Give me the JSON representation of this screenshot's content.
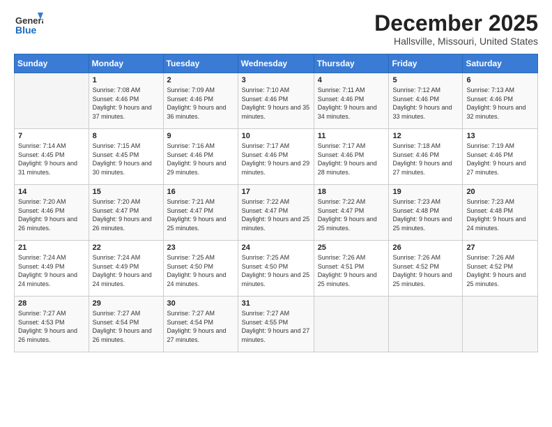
{
  "header": {
    "logo_general": "General",
    "logo_blue": "Blue",
    "title": "December 2025",
    "subtitle": "Hallsville, Missouri, United States"
  },
  "calendar": {
    "days_of_week": [
      "Sunday",
      "Monday",
      "Tuesday",
      "Wednesday",
      "Thursday",
      "Friday",
      "Saturday"
    ],
    "weeks": [
      [
        {
          "day": "",
          "sunrise": "",
          "sunset": "",
          "daylight": ""
        },
        {
          "day": "1",
          "sunrise": "Sunrise: 7:08 AM",
          "sunset": "Sunset: 4:46 PM",
          "daylight": "Daylight: 9 hours and 37 minutes."
        },
        {
          "day": "2",
          "sunrise": "Sunrise: 7:09 AM",
          "sunset": "Sunset: 4:46 PM",
          "daylight": "Daylight: 9 hours and 36 minutes."
        },
        {
          "day": "3",
          "sunrise": "Sunrise: 7:10 AM",
          "sunset": "Sunset: 4:46 PM",
          "daylight": "Daylight: 9 hours and 35 minutes."
        },
        {
          "day": "4",
          "sunrise": "Sunrise: 7:11 AM",
          "sunset": "Sunset: 4:46 PM",
          "daylight": "Daylight: 9 hours and 34 minutes."
        },
        {
          "day": "5",
          "sunrise": "Sunrise: 7:12 AM",
          "sunset": "Sunset: 4:46 PM",
          "daylight": "Daylight: 9 hours and 33 minutes."
        },
        {
          "day": "6",
          "sunrise": "Sunrise: 7:13 AM",
          "sunset": "Sunset: 4:46 PM",
          "daylight": "Daylight: 9 hours and 32 minutes."
        }
      ],
      [
        {
          "day": "7",
          "sunrise": "Sunrise: 7:14 AM",
          "sunset": "Sunset: 4:45 PM",
          "daylight": "Daylight: 9 hours and 31 minutes."
        },
        {
          "day": "8",
          "sunrise": "Sunrise: 7:15 AM",
          "sunset": "Sunset: 4:45 PM",
          "daylight": "Daylight: 9 hours and 30 minutes."
        },
        {
          "day": "9",
          "sunrise": "Sunrise: 7:16 AM",
          "sunset": "Sunset: 4:46 PM",
          "daylight": "Daylight: 9 hours and 29 minutes."
        },
        {
          "day": "10",
          "sunrise": "Sunrise: 7:17 AM",
          "sunset": "Sunset: 4:46 PM",
          "daylight": "Daylight: 9 hours and 29 minutes."
        },
        {
          "day": "11",
          "sunrise": "Sunrise: 7:17 AM",
          "sunset": "Sunset: 4:46 PM",
          "daylight": "Daylight: 9 hours and 28 minutes."
        },
        {
          "day": "12",
          "sunrise": "Sunrise: 7:18 AM",
          "sunset": "Sunset: 4:46 PM",
          "daylight": "Daylight: 9 hours and 27 minutes."
        },
        {
          "day": "13",
          "sunrise": "Sunrise: 7:19 AM",
          "sunset": "Sunset: 4:46 PM",
          "daylight": "Daylight: 9 hours and 27 minutes."
        }
      ],
      [
        {
          "day": "14",
          "sunrise": "Sunrise: 7:20 AM",
          "sunset": "Sunset: 4:46 PM",
          "daylight": "Daylight: 9 hours and 26 minutes."
        },
        {
          "day": "15",
          "sunrise": "Sunrise: 7:20 AM",
          "sunset": "Sunset: 4:47 PM",
          "daylight": "Daylight: 9 hours and 26 minutes."
        },
        {
          "day": "16",
          "sunrise": "Sunrise: 7:21 AM",
          "sunset": "Sunset: 4:47 PM",
          "daylight": "Daylight: 9 hours and 25 minutes."
        },
        {
          "day": "17",
          "sunrise": "Sunrise: 7:22 AM",
          "sunset": "Sunset: 4:47 PM",
          "daylight": "Daylight: 9 hours and 25 minutes."
        },
        {
          "day": "18",
          "sunrise": "Sunrise: 7:22 AM",
          "sunset": "Sunset: 4:47 PM",
          "daylight": "Daylight: 9 hours and 25 minutes."
        },
        {
          "day": "19",
          "sunrise": "Sunrise: 7:23 AM",
          "sunset": "Sunset: 4:48 PM",
          "daylight": "Daylight: 9 hours and 25 minutes."
        },
        {
          "day": "20",
          "sunrise": "Sunrise: 7:23 AM",
          "sunset": "Sunset: 4:48 PM",
          "daylight": "Daylight: 9 hours and 24 minutes."
        }
      ],
      [
        {
          "day": "21",
          "sunrise": "Sunrise: 7:24 AM",
          "sunset": "Sunset: 4:49 PM",
          "daylight": "Daylight: 9 hours and 24 minutes."
        },
        {
          "day": "22",
          "sunrise": "Sunrise: 7:24 AM",
          "sunset": "Sunset: 4:49 PM",
          "daylight": "Daylight: 9 hours and 24 minutes."
        },
        {
          "day": "23",
          "sunrise": "Sunrise: 7:25 AM",
          "sunset": "Sunset: 4:50 PM",
          "daylight": "Daylight: 9 hours and 24 minutes."
        },
        {
          "day": "24",
          "sunrise": "Sunrise: 7:25 AM",
          "sunset": "Sunset: 4:50 PM",
          "daylight": "Daylight: 9 hours and 25 minutes."
        },
        {
          "day": "25",
          "sunrise": "Sunrise: 7:26 AM",
          "sunset": "Sunset: 4:51 PM",
          "daylight": "Daylight: 9 hours and 25 minutes."
        },
        {
          "day": "26",
          "sunrise": "Sunrise: 7:26 AM",
          "sunset": "Sunset: 4:52 PM",
          "daylight": "Daylight: 9 hours and 25 minutes."
        },
        {
          "day": "27",
          "sunrise": "Sunrise: 7:26 AM",
          "sunset": "Sunset: 4:52 PM",
          "daylight": "Daylight: 9 hours and 25 minutes."
        }
      ],
      [
        {
          "day": "28",
          "sunrise": "Sunrise: 7:27 AM",
          "sunset": "Sunset: 4:53 PM",
          "daylight": "Daylight: 9 hours and 26 minutes."
        },
        {
          "day": "29",
          "sunrise": "Sunrise: 7:27 AM",
          "sunset": "Sunset: 4:54 PM",
          "daylight": "Daylight: 9 hours and 26 minutes."
        },
        {
          "day": "30",
          "sunrise": "Sunrise: 7:27 AM",
          "sunset": "Sunset: 4:54 PM",
          "daylight": "Daylight: 9 hours and 27 minutes."
        },
        {
          "day": "31",
          "sunrise": "Sunrise: 7:27 AM",
          "sunset": "Sunset: 4:55 PM",
          "daylight": "Daylight: 9 hours and 27 minutes."
        },
        {
          "day": "",
          "sunrise": "",
          "sunset": "",
          "daylight": ""
        },
        {
          "day": "",
          "sunrise": "",
          "sunset": "",
          "daylight": ""
        },
        {
          "day": "",
          "sunrise": "",
          "sunset": "",
          "daylight": ""
        }
      ]
    ]
  }
}
